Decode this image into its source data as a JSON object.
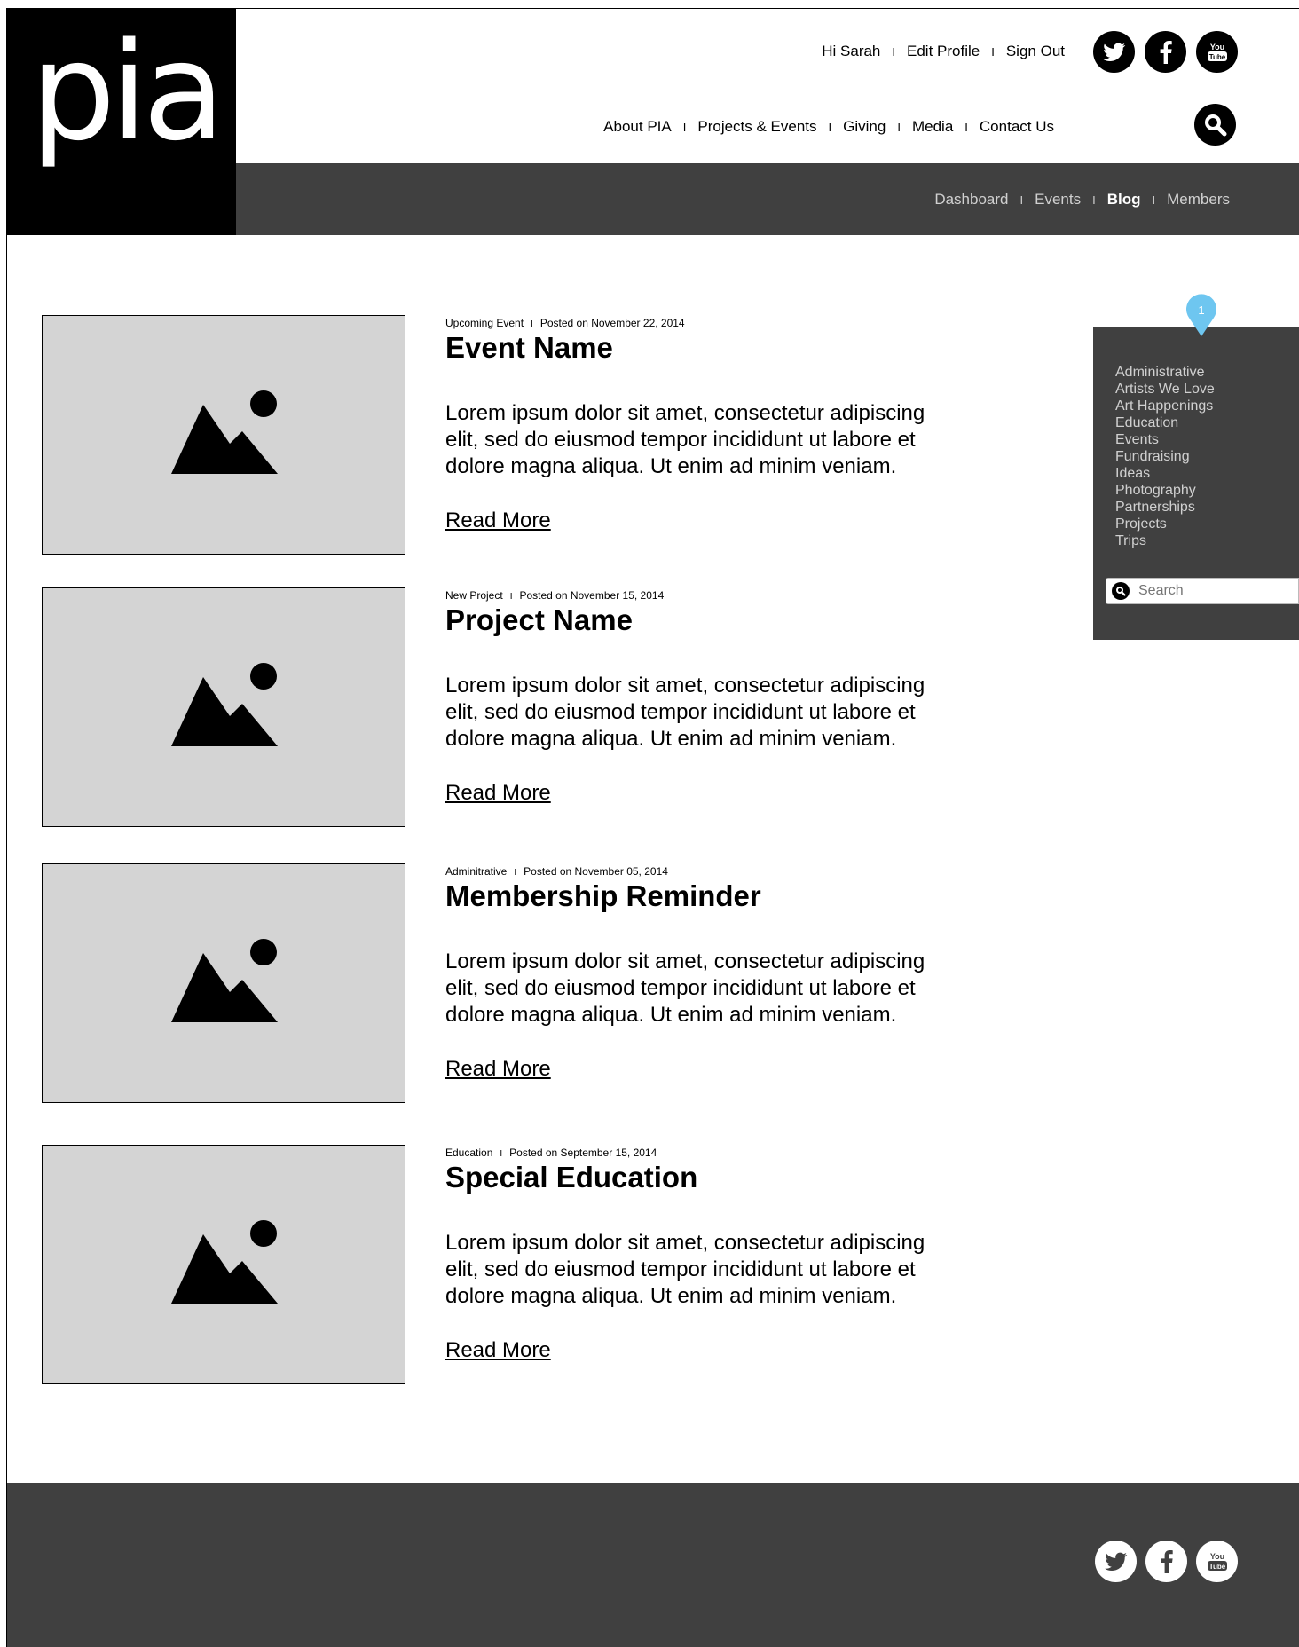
{
  "logo": {
    "text": "pia"
  },
  "header": {
    "user_links": [
      "Hi Sarah",
      "Edit Profile",
      "Sign Out"
    ],
    "separator": "I",
    "main_nav": [
      "About PIA",
      "Projects & Events",
      "Giving",
      "Media",
      "Contact Us"
    ],
    "social": [
      "twitter-icon",
      "facebook-icon",
      "youtube-icon"
    ],
    "youtube_text_top": "You",
    "youtube_text_bottom": "Tube"
  },
  "sub_nav": {
    "items": [
      "Dashboard",
      "Events",
      "Blog",
      "Members"
    ],
    "active": "Blog"
  },
  "posts": [
    {
      "category": "Upcoming Event",
      "date": "Posted on November 22, 2014",
      "title": "Event Name",
      "body": "Lorem ipsum dolor sit amet, consectetur adipiscing elit, sed do eiusmod tempor incididunt ut labore et dolore magna aliqua. Ut enim ad minim veniam.",
      "link": "Read More"
    },
    {
      "category": "New Project",
      "date": "Posted on November 15, 2014",
      "title": "Project Name",
      "body": "Lorem ipsum dolor sit amet, consectetur adipiscing elit, sed do eiusmod tempor incididunt ut labore et dolore magna aliqua. Ut enim ad minim veniam.",
      "link": "Read More"
    },
    {
      "category": "Adminitrative",
      "date": "Posted on November 05, 2014",
      "title": "Membership Reminder",
      "body": "Lorem ipsum dolor sit amet, consectetur adipiscing elit, sed do eiusmod tempor incididunt ut labore et dolore magna aliqua. Ut enim ad minim veniam.",
      "link": "Read More"
    },
    {
      "category": "Education",
      "date": "Posted on September 15, 2014",
      "title": "Special Education",
      "body": "Lorem ipsum dolor sit amet, consectetur adipiscing elit, sed do eiusmod tempor incididunt ut labore et dolore magna aliqua. Ut enim ad minim veniam.",
      "link": "Read More"
    }
  ],
  "sidebar": {
    "pin_number": "1",
    "categories": [
      "Administrative",
      "Artists We Love",
      "Art Happenings",
      "Education",
      "Events",
      "Fundraising",
      "Ideas",
      "Photography",
      "Partnerships",
      "Projects",
      "Trips"
    ],
    "search_placeholder": "Search"
  },
  "colors": {
    "dark_bar": "#404040",
    "pin": "#6ec6f0",
    "thumb": "#d4d4d4"
  }
}
